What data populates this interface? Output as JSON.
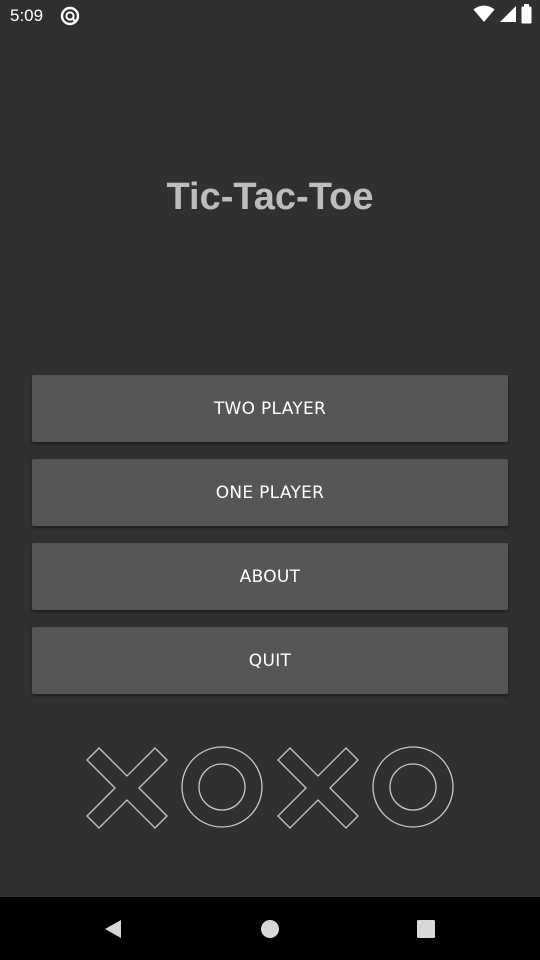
{
  "status_bar": {
    "time": "5:09",
    "app_icon": "no-disturb-badge-icon",
    "icons": [
      "wifi-icon",
      "cell-signal-icon",
      "battery-icon"
    ]
  },
  "title": "Tic-Tac-Toe",
  "menu": {
    "two_player": "TWO PLAYER",
    "one_player": "ONE PLAYER",
    "about": "ABOUT",
    "quit": "QUIT"
  },
  "decoration": [
    "x-mark-icon",
    "o-mark-icon",
    "x-mark-icon",
    "o-mark-icon"
  ],
  "nav_bar": {
    "buttons": [
      "back-icon",
      "home-icon",
      "recents-icon"
    ]
  },
  "colors": {
    "background": "#303030",
    "button": "#565656",
    "title": "#bdbdbd",
    "button_text": "#ffffff",
    "nav_bar": "#000000"
  }
}
